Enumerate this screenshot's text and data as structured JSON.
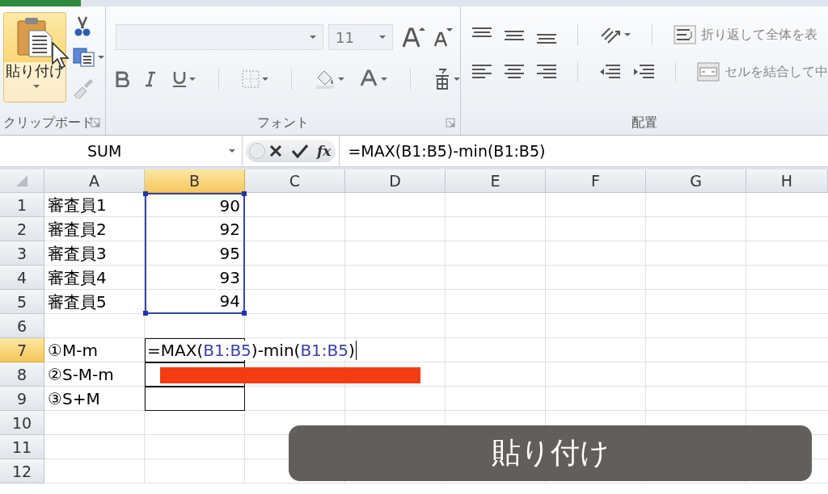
{
  "ribbon": {
    "clipboard": {
      "paste_label": "貼り付け",
      "label": "クリップボード"
    },
    "font": {
      "font_size": "11",
      "label": "フォント"
    },
    "alignment": {
      "wrap_text": "折り返して全体を表",
      "merge_center": "セルを結合して中",
      "label": "配置"
    }
  },
  "formula_bar": {
    "name_box": "SUM",
    "function_button": "fx",
    "formula": "=MAX(B1:B5)-min(B1:B5)"
  },
  "sheet": {
    "columns": [
      {
        "label": "A",
        "selected": false
      },
      {
        "label": "B",
        "selected": true
      },
      {
        "label": "C",
        "selected": false
      },
      {
        "label": "D",
        "selected": false
      },
      {
        "label": "E",
        "selected": false
      },
      {
        "label": "F",
        "selected": false
      },
      {
        "label": "G",
        "selected": false
      },
      {
        "label": "H",
        "selected": false
      }
    ],
    "rows": [
      {
        "label": "1",
        "selected": false,
        "in_range": true,
        "boxed": false,
        "cells": [
          "審査員1",
          "90"
        ]
      },
      {
        "label": "2",
        "selected": false,
        "in_range": true,
        "boxed": false,
        "cells": [
          "審査員2",
          "92"
        ]
      },
      {
        "label": "3",
        "selected": false,
        "in_range": true,
        "boxed": false,
        "cells": [
          "審査員3",
          "95"
        ]
      },
      {
        "label": "4",
        "selected": false,
        "in_range": true,
        "boxed": false,
        "cells": [
          "審査員4",
          "93"
        ]
      },
      {
        "label": "5",
        "selected": false,
        "in_range": true,
        "boxed": false,
        "cells": [
          "審査員5",
          "94"
        ]
      },
      {
        "label": "6",
        "selected": false,
        "in_range": false,
        "boxed": false,
        "cells": []
      },
      {
        "label": "7",
        "selected": true,
        "in_range": false,
        "boxed": false,
        "cells": [
          "①M-m"
        ],
        "editor": [
          {
            "kind": "plain",
            "text": "=MAX("
          },
          {
            "kind": "ref",
            "text": "B1:B5"
          },
          {
            "kind": "plain",
            "text": ")-min("
          },
          {
            "kind": "ref",
            "text": "B1:B5"
          },
          {
            "kind": "plain",
            "text": ")"
          }
        ]
      },
      {
        "label": "8",
        "selected": false,
        "in_range": false,
        "boxed": true,
        "cells": [
          "②S-M-m"
        ]
      },
      {
        "label": "9",
        "selected": false,
        "in_range": false,
        "boxed": true,
        "cells": [
          "③S+M"
        ]
      },
      {
        "label": "10",
        "selected": false,
        "in_range": false,
        "boxed": false,
        "cells": []
      },
      {
        "label": "11",
        "selected": false,
        "in_range": false,
        "boxed": false,
        "cells": []
      },
      {
        "label": "12",
        "selected": false,
        "in_range": false,
        "boxed": false,
        "cells": []
      }
    ]
  },
  "annotation": {
    "kind": "bar"
  },
  "caption": {
    "text": "貼り付け"
  }
}
